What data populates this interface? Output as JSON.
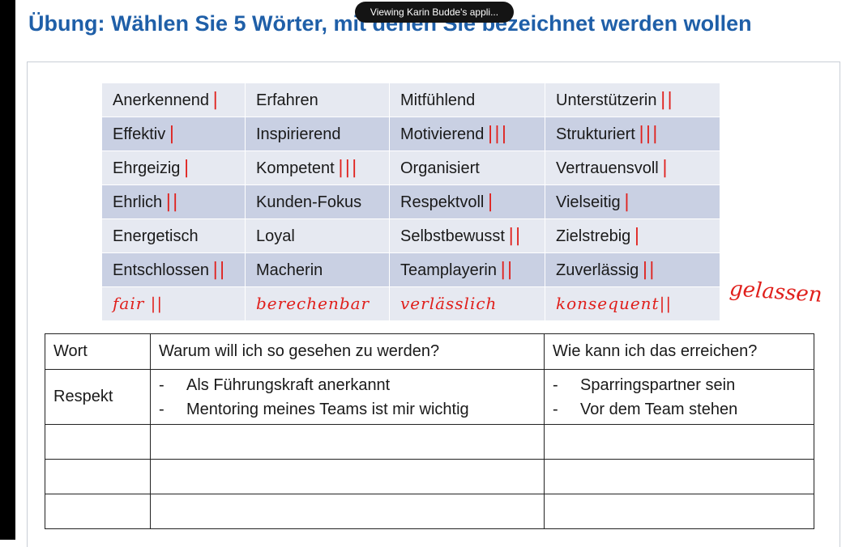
{
  "title": "Übung: Wählen Sie 5 Wörter, mit denen Sie bezeichnet werden wollen",
  "banner": "Viewing Karin Budde's appli...",
  "words": {
    "rows": [
      [
        {
          "word": "Anerkennend",
          "tally": "|"
        },
        {
          "word": "Erfahren",
          "tally": ""
        },
        {
          "word": "Mitfühlend",
          "tally": ""
        },
        {
          "word": "Unterstützerin",
          "tally": "||"
        }
      ],
      [
        {
          "word": "Effektiv",
          "tally": "|"
        },
        {
          "word": "Inspirierend",
          "tally": ""
        },
        {
          "word": "Motivierend",
          "tally": "|||"
        },
        {
          "word": "Strukturiert",
          "tally": "|||"
        }
      ],
      [
        {
          "word": "Ehrgeizig",
          "tally": "|"
        },
        {
          "word": "Kompetent",
          "tally": "|||"
        },
        {
          "word": "Organisiert",
          "tally": ""
        },
        {
          "word": "Vertrauensvoll",
          "tally": "|"
        }
      ],
      [
        {
          "word": "Ehrlich",
          "tally": "||"
        },
        {
          "word": "Kunden-Fokus",
          "tally": ""
        },
        {
          "word": "Respektvoll",
          "tally": "|"
        },
        {
          "word": "Vielseitig",
          "tally": "|"
        }
      ],
      [
        {
          "word": "Energetisch",
          "tally": ""
        },
        {
          "word": "Loyal",
          "tally": ""
        },
        {
          "word": "Selbstbewusst",
          "tally": "||"
        },
        {
          "word": "Zielstrebig",
          "tally": "|"
        }
      ],
      [
        {
          "word": "Entschlossen",
          "tally": "||"
        },
        {
          "word": "Macherin",
          "tally": ""
        },
        {
          "word": "Teamplayerin",
          "tally": "||"
        },
        {
          "word": "Zuverlässig",
          "tally": "||"
        }
      ]
    ],
    "handwritten": [
      "fair ||",
      "berechenbar",
      "verlässlich",
      "konsequent||"
    ],
    "extra": "gelassen"
  },
  "plan": {
    "headers": [
      "Wort",
      "Warum will ich so gesehen zu werden?",
      "Wie kann ich das erreichen?"
    ],
    "row1": {
      "wort": "Respekt",
      "why": [
        "Als Führungskraft anerkannt",
        "Mentoring meines Teams ist mir wichtig"
      ],
      "how": [
        "Sparringspartner sein",
        "Vor dem Team stehen"
      ]
    },
    "dash": "-"
  },
  "colors": {
    "title": "#1f5fa8",
    "ink": "#e0201c",
    "cell_light": "#e6e9f1",
    "cell_dark": "#c9d0e3"
  }
}
